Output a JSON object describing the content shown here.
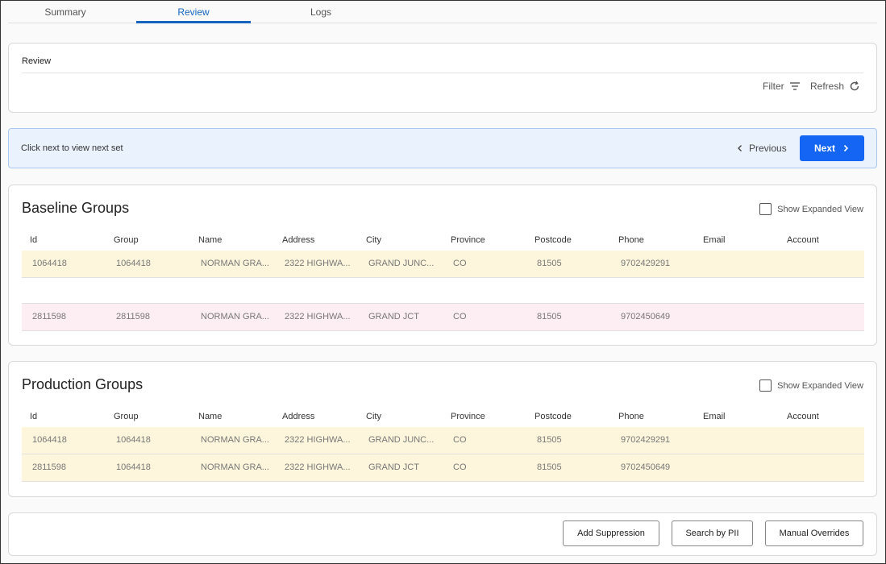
{
  "tabs": [
    {
      "label": "Summary"
    },
    {
      "label": "Review"
    },
    {
      "label": "Logs"
    }
  ],
  "review": {
    "title": "Review",
    "filter_label": "Filter",
    "refresh_label": "Refresh"
  },
  "info": {
    "text": "Click next to view next set",
    "previous_label": "Previous",
    "next_label": "Next"
  },
  "columns": [
    "Id",
    "Group",
    "Name",
    "Address",
    "City",
    "Province",
    "Postcode",
    "Phone",
    "Email",
    "Account"
  ],
  "baseline": {
    "title": "Baseline Groups",
    "expand_label": "Show Expanded View",
    "rows": [
      {
        "id": "1064418",
        "group": "1064418",
        "name": "NORMAN GRA...",
        "address": "2322 HIGHWA...",
        "city": "GRAND JUNC...",
        "province": "CO",
        "postcode": "81505",
        "phone": "9702429291",
        "email": "",
        "account": ""
      },
      {
        "id": "2811598",
        "group": "2811598",
        "name": "NORMAN GRA...",
        "address": "2322 HIGHWA...",
        "city": "GRAND JCT",
        "province": "CO",
        "postcode": "81505",
        "phone": "9702450649",
        "email": "",
        "account": ""
      }
    ]
  },
  "production": {
    "title": "Production Groups",
    "expand_label": "Show Expanded View",
    "rows": [
      {
        "id": "1064418",
        "group": "1064418",
        "name": "NORMAN GRA...",
        "address": "2322 HIGHWA...",
        "city": "GRAND JUNC...",
        "province": "CO",
        "postcode": "81505",
        "phone": "9702429291",
        "email": "",
        "account": ""
      },
      {
        "id": "2811598",
        "group": "1064418",
        "name": "NORMAN GRA...",
        "address": "2322 HIGHWA...",
        "city": "GRAND JCT",
        "province": "CO",
        "postcode": "81505",
        "phone": "9702450649",
        "email": "",
        "account": ""
      }
    ]
  },
  "footer": {
    "add_suppression": "Add Suppression",
    "search_pii": "Search by PII",
    "manual_overrides": "Manual Overrides"
  },
  "colors": {
    "accent": "#1565f5",
    "row_yellow": "#fdf6dc",
    "row_pink": "#fdeef3",
    "info_bg": "#eaf2fd"
  }
}
